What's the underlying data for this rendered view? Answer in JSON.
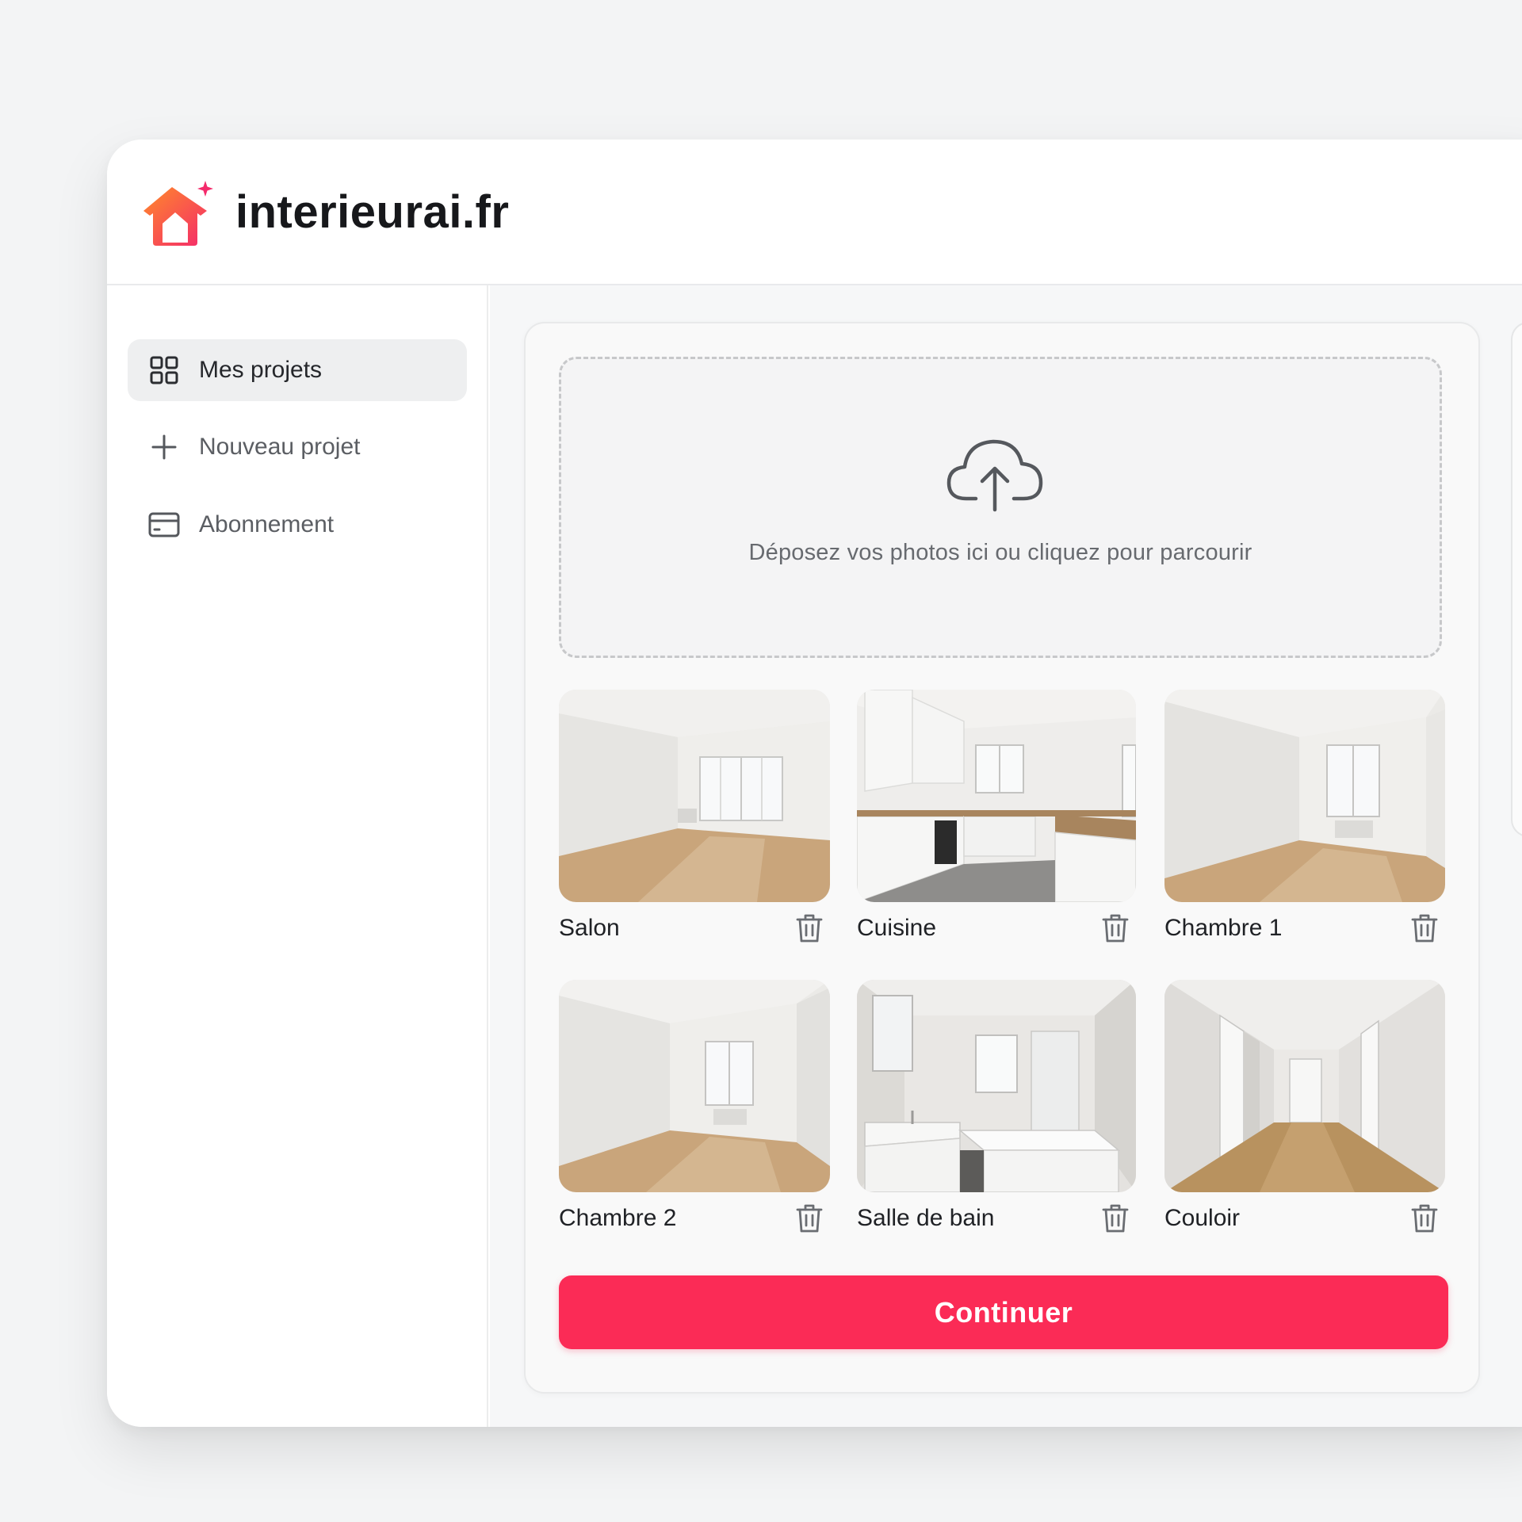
{
  "brand": {
    "name": "interieurai.fr",
    "logo_icon": "house-sparkle-icon",
    "colors": {
      "orange": "#ff7a2e",
      "pink": "#f7306a"
    }
  },
  "sidebar": {
    "items": [
      {
        "label": "Mes projets",
        "icon": "grid-icon",
        "active": true
      },
      {
        "label": "Nouveau projet",
        "icon": "plus-icon",
        "active": false
      },
      {
        "label": "Abonnement",
        "icon": "credit-card-icon",
        "active": false
      }
    ]
  },
  "upload": {
    "icon": "cloud-upload-icon",
    "text": "Déposez vos photos ici ou cliquez pour parcourir"
  },
  "photos": [
    {
      "label": "Salon",
      "scene": "living-room"
    },
    {
      "label": "Cuisine",
      "scene": "kitchen"
    },
    {
      "label": "Chambre 1",
      "scene": "bedroom"
    },
    {
      "label": "Chambre 2",
      "scene": "bedroom"
    },
    {
      "label": "Salle de bain",
      "scene": "bathroom"
    },
    {
      "label": "Couloir",
      "scene": "hallway"
    }
  ],
  "actions": {
    "continue_label": "Continuer",
    "accent_color": "#fb2b56"
  }
}
